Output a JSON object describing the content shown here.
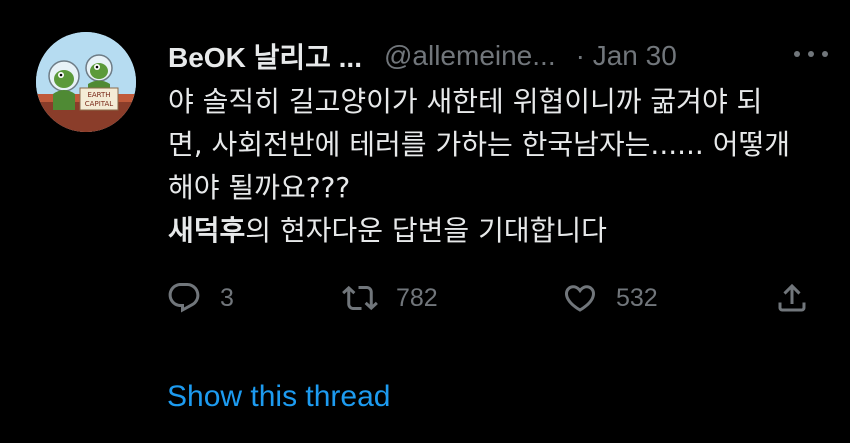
{
  "tweet": {
    "author_name": "BeOK 날리고 ...",
    "handle": "@allemeine...",
    "date_sep": "·",
    "date": "Jan 30",
    "avatar_sign": [
      "EARTH",
      "CAPITAL"
    ],
    "text_lines": [
      "야 솔직히 길고양이가 새한테 위협이니까 굶겨야 되",
      "면, 사회전반에 테러를 가하는 한국남자는...... 어떻개",
      "해야 될까요???"
    ],
    "last_line_bold": "새덕후",
    "last_line_rest": "의 현자다운 답변을 기대합니다",
    "replies": "3",
    "retweets": "782",
    "likes": "532"
  },
  "show_thread_label": "Show this thread",
  "colors": {
    "background": "#000000",
    "text": "#e7e9ea",
    "secondary": "#71767b",
    "link": "#1d9bf0"
  }
}
